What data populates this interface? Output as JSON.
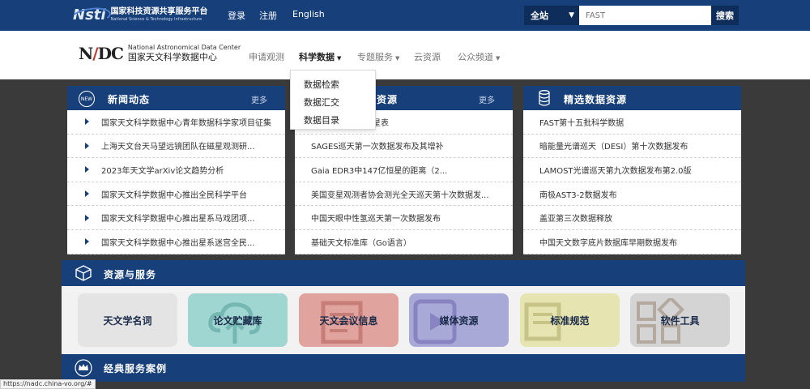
{
  "topbar": {
    "logo_mark": "Nsti",
    "logo_cn": "国家科技资源共享服务平台",
    "logo_en": "National Science & Technology Infrastructure",
    "login": "登录",
    "register": "注册",
    "english": "English",
    "scope": "全站",
    "search_value": "FAST",
    "search_button": "搜索"
  },
  "header": {
    "logo_mark": "NADC",
    "logo_en": "National Astronomical Data Center",
    "logo_cn": "国家天文科学数据中心",
    "nav": [
      "申请观测",
      "科学数据",
      "专题服务",
      "云资源",
      "公众频道"
    ]
  },
  "dropdown": [
    "数据检索",
    "数据汇交",
    "数据目录"
  ],
  "news": {
    "badge": "NEW",
    "title": "新闻动态",
    "more": "更多",
    "items": [
      "国家天文科学数据中心青年数据科学家项目征集",
      "上海天文台天马望远镜团队在磁星观测研...",
      "2023年天文学arXiv论文趋势分析",
      "国家天文科学数据中心推出全民科学平台",
      "国家天文科学数据中心推出星系马戏团项...",
      "国家天文科学数据中心推出星系迷宫全民..."
    ]
  },
  "resources": {
    "title": "据资源",
    "more": "更多",
    "items": [
      "考星表",
      "SAGES巡天第一次数据发布及其增补",
      "Gaia EDR3中147亿恒星的距离（2...",
      "美国变星观测者协会测光全天巡天第十次数据发...",
      "中国天眼中性氢巡天第一次数据发布",
      "基础天文标准库（Go语言）"
    ]
  },
  "featured": {
    "title": "精选数据资源",
    "items": [
      "FAST第十五批科学数据",
      "暗能量光谱巡天（DESI）第十次数据发布",
      "LAMOST光谱巡天第九次数据发布第2.0版",
      "南极AST3-2数据发布",
      "盖亚第三次数据释放",
      "中国天文数字底片数据库早期数据发布"
    ]
  },
  "services": {
    "title": "资源与服务",
    "cards": [
      {
        "label": "天文学名词",
        "color": "#e4e4e4"
      },
      {
        "label": "论文贮藏库",
        "color": "#9fd6d2"
      },
      {
        "label": "天文会议信息",
        "color": "#e0a39e"
      },
      {
        "label": "媒体资源",
        "color": "#a9a9d8"
      },
      {
        "label": "标准规范",
        "color": "#e6e4b0"
      },
      {
        "label": "软件工具",
        "color": "#d4d4d4"
      }
    ]
  },
  "cases": {
    "title": "经典服务案例"
  },
  "status_url": "https://nadc.china-vo.org/#"
}
